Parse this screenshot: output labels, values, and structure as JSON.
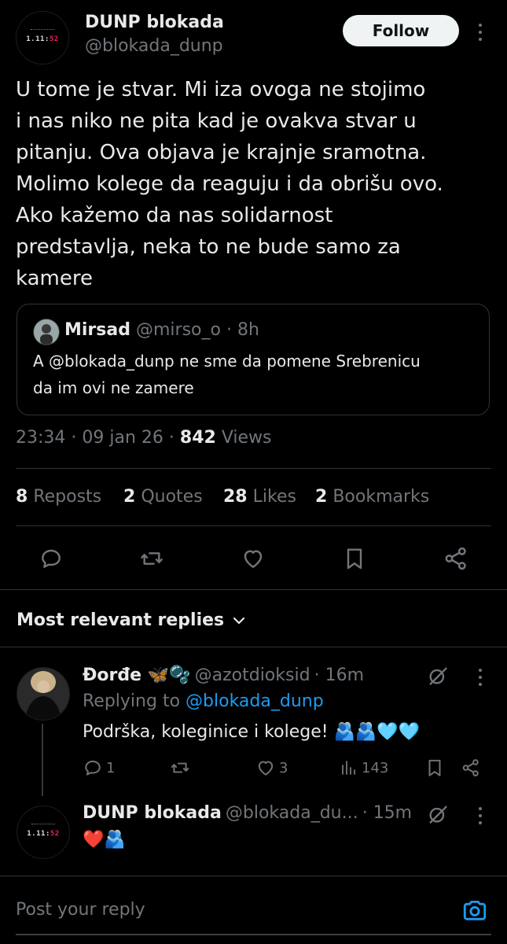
{
  "author": {
    "name": "DUNP blokada",
    "handle": "@blokada_dunp",
    "avatar_text": "1.11",
    "avatar_text_red": "52",
    "follow_label": "Follow"
  },
  "tweet": {
    "text": "U tome je stvar. Mi iza ovoga ne stojimo\ni nas niko ne pita kad je ovakva stvar u\npitanju. Ova objava je krajnje sramotna.\nMolimo kolege da reaguju i da obrišu ovo.\nAko kažemo da nas solidarnost\npredstavlja, neka to ne bude samo za\nkamere",
    "quote": {
      "name": "Mirsad",
      "handle": "@mirso_o",
      "time": "· 8h",
      "text_line1": "A @blokada_dunp ne sme da pomene Srebrenicu",
      "text_line2": "da im ovi ne zamere"
    },
    "meta_time": "23:34 · 09 jan 26 ·",
    "views_count": "842",
    "views_label": "Views"
  },
  "stats": {
    "reposts_count": "8",
    "reposts_label": "Reposts",
    "quotes_count": "2",
    "quotes_label": "Quotes",
    "likes_count": "28",
    "likes_label": "Likes",
    "bookmarks_count": "2",
    "bookmarks_label": "Bookmarks"
  },
  "icons": {
    "reply": "reply-icon",
    "repost": "repost-icon",
    "like": "heart-icon",
    "bookmark": "bookmark-icon",
    "share": "share-icon",
    "grok": "grok-icon",
    "views": "views-icon",
    "camera": "camera-icon",
    "more": "more-icon"
  },
  "replies_header": "Most relevant replies",
  "replies": [
    {
      "name": "Đorđe 🦋🫧",
      "handle": "@azotdioksid",
      "time": "· 16m",
      "replying_prefix": "Replying to",
      "replying_handle": "@blokada_dunp",
      "text": "Podrška, koleginice i kolege! 🫂🫂🩵🩵",
      "reply_count": "1",
      "repost_count": "",
      "like_count": "3",
      "views_count": "143"
    },
    {
      "name": "DUNP blokada",
      "handle": "@blokada_du...",
      "time": "· 15m",
      "text": "❤️🫂"
    }
  ],
  "composer": {
    "placeholder": "Post your reply"
  },
  "colors": {
    "background": "#000000",
    "text": "#e7e9ea",
    "muted": "#71767b",
    "link": "#1d9bf0",
    "border": "#2f3336",
    "follow_bg": "#eff3f4"
  }
}
